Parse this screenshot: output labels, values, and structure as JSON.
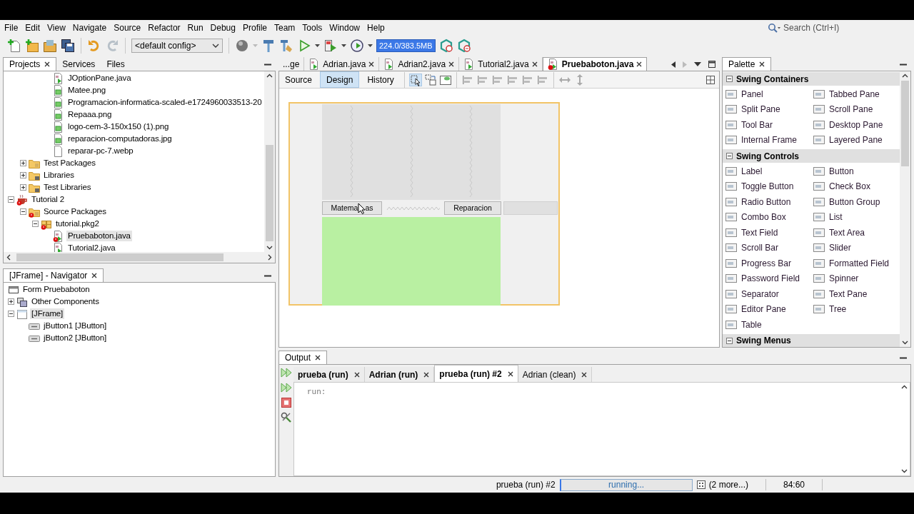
{
  "menu": [
    "File",
    "Edit",
    "View",
    "Navigate",
    "Source",
    "Refactor",
    "Run",
    "Debug",
    "Profile",
    "Team",
    "Tools",
    "Window",
    "Help"
  ],
  "search": {
    "placeholder": "Search (Ctrl+I)"
  },
  "toolbar": {
    "config": "<default config>",
    "memory": "224.0/383.5MB"
  },
  "projects_panel": {
    "tabs": [
      {
        "label": "Projects",
        "selected": true,
        "closable": true
      },
      {
        "label": "Services",
        "selected": false,
        "closable": false
      },
      {
        "label": "Files",
        "selected": false,
        "closable": false
      }
    ],
    "tree": [
      {
        "children": [
          {
            "children": [
              {
                "children": [
                  {
                    "label": "JOptionPane.java",
                    "kind": "java",
                    "error": false,
                    "selected": false
                  },
                  {
                    "label": "Matee.png",
                    "kind": "image",
                    "error": false,
                    "selected": false
                  },
                  {
                    "label": "Programacion-informatica-scaled-e1724960033513-20",
                    "kind": "image",
                    "error": false,
                    "selected": false
                  },
                  {
                    "label": "Repaaa.png",
                    "kind": "image",
                    "error": false,
                    "selected": false
                  },
                  {
                    "label": "logo-cem-3-150x150 (1).png",
                    "kind": "image",
                    "error": false,
                    "selected": false
                  },
                  {
                    "label": "reparacion-computadoras.jpg",
                    "kind": "image",
                    "error": false,
                    "selected": false
                  },
                  {
                    "label": "reparar-pc-7.webp",
                    "kind": "file",
                    "error": false,
                    "selected": false
                  }
                ]
              }
            ]
          },
          {
            "label": "Test Packages",
            "kind": "folder",
            "expanded": false,
            "error": false,
            "selected": false
          },
          {
            "label": "Libraries",
            "kind": "library",
            "expanded": false,
            "error": false,
            "selected": false
          },
          {
            "label": "Test Libraries",
            "kind": "library",
            "expanded": false,
            "error": false,
            "selected": false
          }
        ]
      },
      {
        "label": "Tutorial 2",
        "kind": "project",
        "expanded": true,
        "error": true,
        "selected": false,
        "children": [
          {
            "label": "Source Packages",
            "kind": "folder",
            "expanded": true,
            "error": true,
            "selected": false,
            "children": [
              {
                "label": "tutorial.pkg2",
                "kind": "package",
                "expanded": true,
                "error": true,
                "selected": false,
                "children": [
                  {
                    "label": "Pruebaboton.java",
                    "kind": "java",
                    "error": true,
                    "selected": true
                  },
                  {
                    "label": "Tutorial2.java",
                    "kind": "java",
                    "error": false,
                    "selected": false
                  }
                ]
              }
            ]
          }
        ]
      }
    ]
  },
  "navigator": {
    "title": "[JFrame] - Navigator",
    "root": {
      "label": "Form Pruebaboton",
      "kind": "form"
    },
    "tree": [
      {
        "label": "Other Components",
        "kind": "components",
        "expanded": false,
        "error": false,
        "selected": false
      },
      {
        "label": "[JFrame]",
        "kind": "frame",
        "expanded": true,
        "error": false,
        "selected": true,
        "children": [
          {
            "label": "jButton1 [JButton]",
            "kind": "button",
            "error": false,
            "selected": false
          },
          {
            "label": "jButton2 [JButton]",
            "kind": "button",
            "error": false,
            "selected": false
          }
        ]
      }
    ]
  },
  "editor": {
    "tabs": [
      {
        "label": "...ge",
        "selected": false,
        "closable": false,
        "error": false
      },
      {
        "label": "Adrian.java",
        "selected": false,
        "closable": true,
        "error": false
      },
      {
        "label": "Adrian2.java",
        "selected": false,
        "closable": true,
        "error": false
      },
      {
        "label": "Tutorial2.java",
        "selected": false,
        "closable": true,
        "error": false
      },
      {
        "label": "Pruebaboton.java",
        "selected": true,
        "closable": true,
        "error": true
      }
    ],
    "views": [
      {
        "label": "Source",
        "selected": false
      },
      {
        "label": "Design",
        "selected": true
      },
      {
        "label": "History",
        "selected": false
      }
    ],
    "form": {
      "buttons": [
        {
          "parts": [
            "Matema",
            "as"
          ]
        },
        {
          "parts": [
            "Reparacion"
          ]
        }
      ]
    }
  },
  "palette": {
    "title": "Palette",
    "categories": [
      {
        "label": "Swing Containers",
        "expanded": true,
        "items": [
          "Panel",
          "Tabbed Pane",
          "Split Pane",
          "Scroll Pane",
          "Tool Bar",
          "Desktop Pane",
          "Internal Frame",
          "Layered Pane"
        ]
      },
      {
        "label": "Swing Controls",
        "expanded": true,
        "items": [
          "Label",
          "Button",
          "Toggle Button",
          "Check Box",
          "Radio Button",
          "Button Group",
          "Combo Box",
          "List",
          "Text Field",
          "Text Area",
          "Scroll Bar",
          "Slider",
          "Progress Bar",
          "Formatted Field",
          "Password Field",
          "Spinner",
          "Separator",
          "Text Pane",
          "Editor Pane",
          "Tree",
          "Table"
        ]
      },
      {
        "label": "Swing Menus",
        "expanded": true
      }
    ]
  },
  "output": {
    "title": "Output",
    "tabs": [
      {
        "label": "prueba (run)",
        "selected": false,
        "active": true
      },
      {
        "label": "Adrian (run)",
        "selected": false,
        "active": true
      },
      {
        "label": "prueba (run) #2",
        "selected": true,
        "active": true
      },
      {
        "label": "Adrian (clean)",
        "selected": false,
        "active": false
      }
    ],
    "lines": [
      "run:"
    ]
  },
  "status_bar": {
    "task": "prueba (run) #2",
    "progress": "running...",
    "more": "(2 more...)",
    "position": "84:60"
  }
}
